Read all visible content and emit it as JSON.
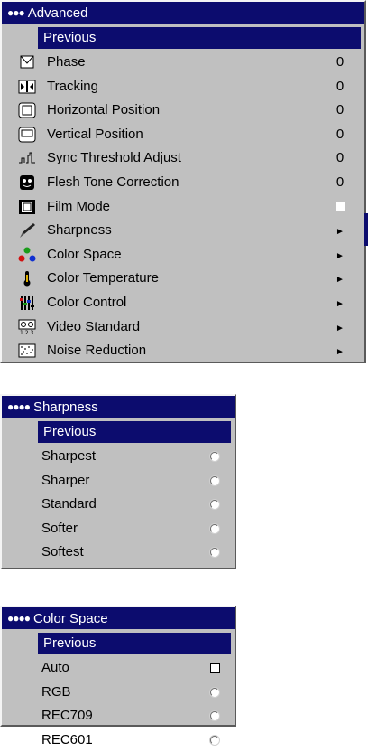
{
  "advanced_menu": {
    "title": "Advanced",
    "previous": "Previous",
    "items": [
      {
        "label": "Phase",
        "value": "0",
        "icon": "phase-icon"
      },
      {
        "label": "Tracking",
        "value": "0",
        "icon": "tracking-icon"
      },
      {
        "label": "Horizontal Position",
        "value": "0",
        "icon": "horizontal-position-icon"
      },
      {
        "label": "Vertical Position",
        "value": "0",
        "icon": "vertical-position-icon"
      },
      {
        "label": "Sync Threshold Adjust",
        "value": "0",
        "icon": "sync-threshold-icon"
      },
      {
        "label": "Flesh Tone Correction",
        "value": "0",
        "icon": "flesh-tone-icon"
      },
      {
        "label": "Film Mode",
        "value": "checkbox-unchecked",
        "icon": "film-mode-icon"
      },
      {
        "label": "Sharpness",
        "value": "submenu",
        "icon": "sharpness-icon"
      },
      {
        "label": "Color Space",
        "value": "submenu",
        "icon": "color-space-icon"
      },
      {
        "label": "Color Temperature",
        "value": "submenu",
        "icon": "color-temperature-icon"
      },
      {
        "label": "Color Control",
        "value": "submenu",
        "icon": "color-control-icon"
      },
      {
        "label": "Video Standard",
        "value": "submenu",
        "icon": "video-standard-icon"
      },
      {
        "label": "Noise Reduction",
        "value": "submenu",
        "icon": "noise-reduction-icon"
      }
    ],
    "arrow_glyph": "►"
  },
  "sharpness_menu": {
    "title": "Sharpness",
    "previous": "Previous",
    "options": [
      "Sharpest",
      "Sharper",
      "Standard",
      "Softer",
      "Softest"
    ]
  },
  "color_space_menu": {
    "title": "Color Space",
    "previous": "Previous",
    "options": [
      {
        "label": "Auto",
        "control": "checkbox"
      },
      {
        "label": "RGB",
        "control": "radio"
      },
      {
        "label": "REC709",
        "control": "radio"
      },
      {
        "label": "REC601",
        "control": "radio"
      }
    ]
  },
  "colors": {
    "title_bg": "#0c0c6e",
    "menu_bg": "#c0c0c0"
  }
}
